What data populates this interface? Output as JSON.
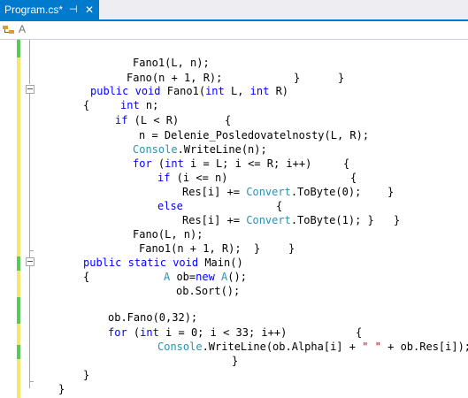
{
  "tab": {
    "title": "Program.cs*",
    "pin_glyph": "⊣",
    "close_glyph": "✕"
  },
  "nav": {
    "class_label": "A",
    "icon": "class-icon"
  },
  "colors": {
    "accent": "#007acc",
    "keyword": "#0000ff",
    "type": "#2b91af",
    "string": "#a31515",
    "saved_change": "#5ac85a",
    "unsaved_change": "#f5e66e"
  },
  "code": {
    "l1": "Fano1(L, n);",
    "l2a": "Fano(n + 1, R);",
    "l2b": "}",
    "l2c": "}",
    "l3_kw1": "public",
    "l3_kw2": "void",
    "l3_name": " Fano1(",
    "l3_kw3": "int",
    "l3_mid": " L, ",
    "l3_kw4": "int",
    "l3_end": " R)",
    "l4_brace": "{",
    "l4_kw": "int",
    "l4_rest": " n;",
    "l5_kw": "if",
    "l5_rest": " (L < R)",
    "l5_brace": "{",
    "l6": "n = Delenie_Posledovatelnosty(L, R);",
    "l7_type": "Console",
    "l7_rest": ".WriteLine(n);",
    "l8_kw1": "for",
    "l8_p1": " (",
    "l8_kw2": "int",
    "l8_rest": " i = L; i <= R; i++)",
    "l8_brace": "{",
    "l9_kw": "if",
    "l9_rest": " (i <= n)",
    "l9_brace": "{",
    "l10_a": "Res[i] += ",
    "l10_type": "Convert",
    "l10_b": ".ToByte(0);",
    "l10_brace": "}",
    "l11_kw": "else",
    "l11_brace": "{",
    "l12_a": "Res[i] += ",
    "l12_type": "Convert",
    "l12_b": ".ToByte(1); }",
    "l12_brace": "}",
    "l13": "Fano(L, n);",
    "l14a": "Fano1(n + 1, R);  }",
    "l14b": "}",
    "l15_kw1": "public",
    "l15_kw2": "static",
    "l15_kw3": "void",
    "l15_rest": " Main()",
    "l16_brace": "{",
    "l16_type1": "A",
    "l16_a": " ob=",
    "l16_kw": "new",
    "l16_type2": " A",
    "l16_b": "();",
    "l17": "ob.Sort();",
    "l19": "ob.Fano(0,32);",
    "l20_kw1": "for",
    "l20_p1": " (",
    "l20_kw2": "int",
    "l20_rest": " i = 0; i < 33; i++)",
    "l20_brace": "{",
    "l21_type": "Console",
    "l21_a": ".WriteLine(ob.Alpha[i] + ",
    "l21_str": "\" \"",
    "l21_b": " + ob.Res[i]);",
    "l22": "}",
    "l23": "}",
    "l24": "}"
  }
}
